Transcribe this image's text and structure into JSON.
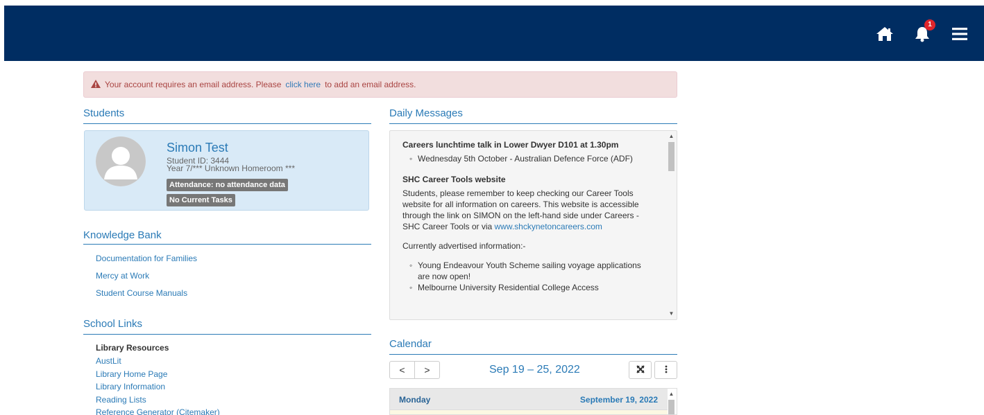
{
  "topbar": {
    "notification_count": "1",
    "icons": [
      "home-icon",
      "bell-icon",
      "hamburger-menu-icon"
    ]
  },
  "alert": {
    "text_before": "Your account requires an email address. Please",
    "link": "click here",
    "text_after": "to add an email address."
  },
  "students": {
    "title": "Students",
    "card": {
      "name": "Simon Test",
      "student_id": "Student ID: 3444",
      "homeroom": "Year 7/*** Unknown Homeroom ***",
      "attendance": "Attendance: no attendance data",
      "tasks": "No Current Tasks"
    }
  },
  "knowledge_bank": {
    "title": "Knowledge Bank",
    "items": [
      "Documentation for Families",
      "Mercy at Work",
      "Student Course Manuals"
    ]
  },
  "school_links": {
    "title": "School Links",
    "group_title": "Library Resources",
    "items": [
      "AustLit",
      "Library Home Page",
      "Library Information",
      "Reading Lists",
      "Reference Generator (Citemaker)"
    ]
  },
  "daily_messages": {
    "title": "Daily Messages",
    "m1_title": "Careers lunchtime talk in Lower Dwyer D101 at 1.30pm",
    "m1_item": "Wednesday 5th October - Australian Defence Force (ADF)",
    "m2_title": "SHC Career Tools website",
    "m2_body": "Students, please remember to keep checking our Career Tools website for all information on careers. This website is accessible through the link on SIMON on the left-hand side under Careers - SHC Career Tools or via",
    "m2_link": "www.shckynetoncareers.com",
    "m3_intro": "Currently advertised information:-",
    "m3_items": [
      "Young Endeavour Youth Scheme sailing voyage applications are now open!",
      "Melbourne University Residential College Access"
    ]
  },
  "calendar": {
    "title": "Calendar",
    "range": "Sep 19 – 25, 2022",
    "prev": "<",
    "next": ">",
    "day": "Monday",
    "date": "September 19, 2022"
  },
  "colors": {
    "navy": "#002d62",
    "link": "#2a7ab6",
    "alert_bg": "#f2dede",
    "card_bg": "#d9eaf7",
    "badge": "#e0262b"
  }
}
